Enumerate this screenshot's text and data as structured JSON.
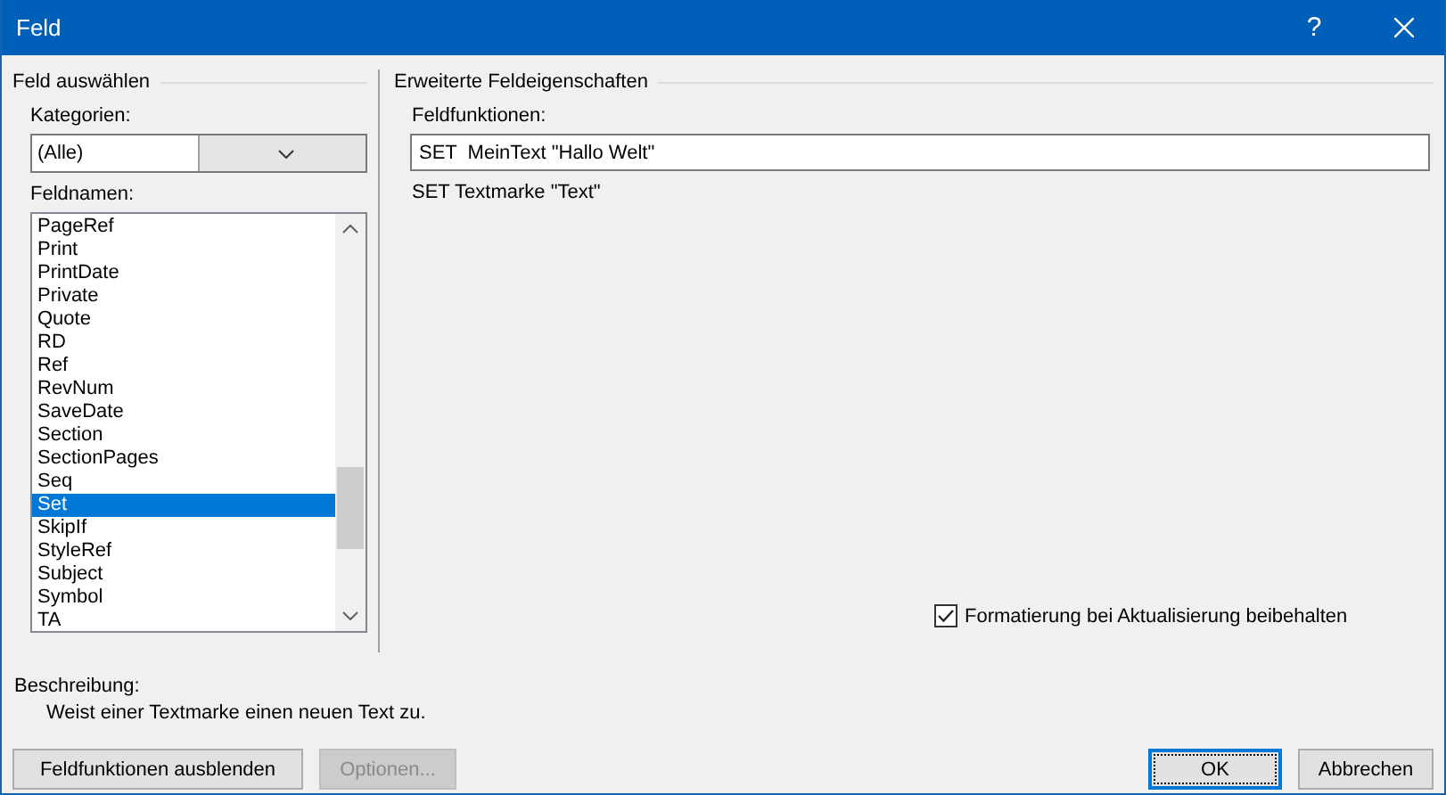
{
  "window": {
    "title": "Feld",
    "help": "?"
  },
  "select_field": {
    "title": "Feld auswählen",
    "categories_label": "Kategorien:",
    "category": "(Alle)",
    "field_names_label": "Feldnamen:",
    "field_names": [
      {
        "label": "PageRef",
        "selected": false
      },
      {
        "label": "Print",
        "selected": false
      },
      {
        "label": "PrintDate",
        "selected": false
      },
      {
        "label": "Private",
        "selected": false
      },
      {
        "label": "Quote",
        "selected": false
      },
      {
        "label": "RD",
        "selected": false
      },
      {
        "label": "Ref",
        "selected": false
      },
      {
        "label": "RevNum",
        "selected": false
      },
      {
        "label": "SaveDate",
        "selected": false
      },
      {
        "label": "Section",
        "selected": false
      },
      {
        "label": "SectionPages",
        "selected": false
      },
      {
        "label": "Seq",
        "selected": false
      },
      {
        "label": "Set",
        "selected": true
      },
      {
        "label": "SkipIf",
        "selected": false
      },
      {
        "label": "StyleRef",
        "selected": false
      },
      {
        "label": "Subject",
        "selected": false
      },
      {
        "label": "Symbol",
        "selected": false
      },
      {
        "label": "TA",
        "selected": false
      }
    ]
  },
  "advanced": {
    "title": "Erweiterte Feldeigenschaften",
    "codes_label": "Feldfunktionen:",
    "codes_value": "SET  MeinText \"Hallo Welt\"",
    "syntax_hint": "SET Textmarke \"Text\"",
    "preserve_formatting": {
      "label": "Formatierung bei Aktualisierung beibehalten",
      "checked": true
    }
  },
  "description": {
    "label": "Beschreibung:",
    "text": "Weist einer Textmarke einen neuen Text zu."
  },
  "buttons": [
    {
      "label": "Feldfunktionen ausblenden",
      "disabled": false,
      "default": false
    },
    {
      "label": "Optionen...",
      "disabled": true,
      "default": false
    },
    {
      "label": "OK",
      "disabled": false,
      "default": true
    },
    {
      "label": "Abbrechen",
      "disabled": false,
      "default": false
    }
  ]
}
